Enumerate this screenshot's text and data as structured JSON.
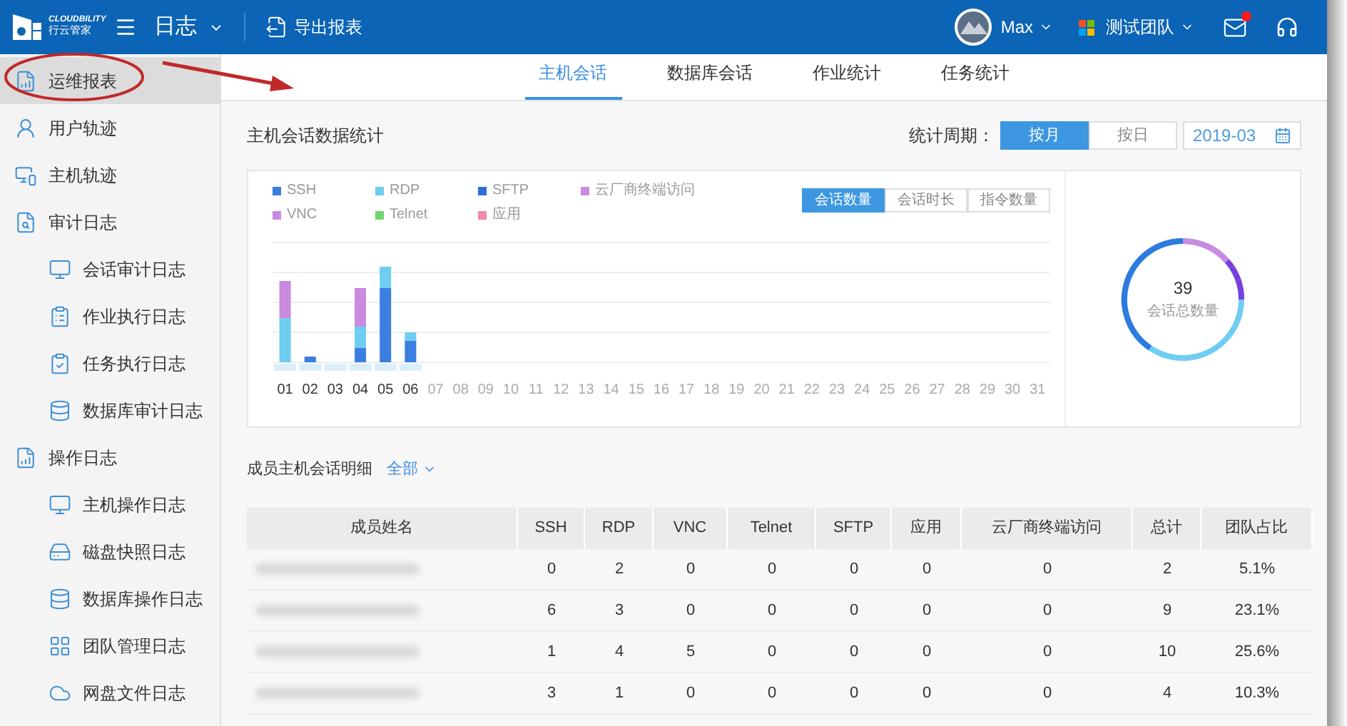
{
  "header": {
    "brand_top": "CLOUDBILITY",
    "brand_bottom": "行云管家",
    "module": "日志",
    "export": "导出报表",
    "user": "Max",
    "team": "测试团队",
    "mail_unread": true
  },
  "sidebar": {
    "items": [
      {
        "label": "运维报表",
        "kind": "report",
        "selected": true
      },
      {
        "label": "用户轨迹",
        "kind": "user",
        "selected": false
      },
      {
        "label": "主机轨迹",
        "kind": "host",
        "selected": false
      },
      {
        "label": "审计日志",
        "kind": "audit",
        "selected": false,
        "children": [
          {
            "label": "会话审计日志",
            "kind": "monitor",
            "selected": false
          },
          {
            "label": "作业执行日志",
            "kind": "clipboard",
            "selected": false
          },
          {
            "label": "任务执行日志",
            "kind": "task",
            "selected": false
          },
          {
            "label": "数据库审计日志",
            "kind": "database",
            "selected": false
          }
        ]
      },
      {
        "label": "操作日志",
        "kind": "report",
        "selected": false,
        "children": [
          {
            "label": "主机操作日志",
            "kind": "monitor",
            "selected": false
          },
          {
            "label": "磁盘快照日志",
            "kind": "disk",
            "selected": false
          },
          {
            "label": "数据库操作日志",
            "kind": "database",
            "selected": false
          },
          {
            "label": "团队管理日志",
            "kind": "grid",
            "selected": false
          },
          {
            "label": "网盘文件日志",
            "kind": "cloud",
            "selected": false
          }
        ]
      }
    ]
  },
  "tabs": [
    {
      "label": "主机会话",
      "selected": true
    },
    {
      "label": "数据库会话",
      "selected": false
    },
    {
      "label": "作业统计",
      "selected": false
    },
    {
      "label": "任务统计",
      "selected": false
    }
  ],
  "stats": {
    "title": "主机会话数据统计",
    "period_label": "统计周期：",
    "periods": [
      {
        "label": "按月",
        "selected": true
      },
      {
        "label": "按日",
        "selected": false
      }
    ],
    "date": "2019-03",
    "legend": [
      {
        "label": "SSH",
        "color": "#3a7fe0"
      },
      {
        "label": "RDP",
        "color": "#6fcdf2"
      },
      {
        "label": "SFTP",
        "color": "#2f6fdc"
      },
      {
        "label": "云厂商终端访问",
        "color": "#c98ae0"
      },
      {
        "label": "VNC",
        "color": "#c68be2"
      },
      {
        "label": "Telnet",
        "color": "#6dd66d"
      },
      {
        "label": "应用",
        "color": "#f28aa6"
      }
    ],
    "metrics": [
      {
        "label": "会话数量",
        "selected": true
      },
      {
        "label": "会话时长",
        "selected": false
      },
      {
        "label": "指令数量",
        "selected": false
      }
    ],
    "days": [
      {
        "label": "01",
        "has_data": true
      },
      {
        "label": "02",
        "has_data": true
      },
      {
        "label": "03",
        "has_data": true
      },
      {
        "label": "04",
        "has_data": true
      },
      {
        "label": "05",
        "has_data": true
      },
      {
        "label": "06",
        "has_data": true
      },
      {
        "label": "07",
        "has_data": false
      },
      {
        "label": "08",
        "has_data": false
      },
      {
        "label": "09",
        "has_data": false
      },
      {
        "label": "10",
        "has_data": false
      },
      {
        "label": "11",
        "has_data": false
      },
      {
        "label": "12",
        "has_data": false
      },
      {
        "label": "13",
        "has_data": false
      },
      {
        "label": "14",
        "has_data": false
      },
      {
        "label": "15",
        "has_data": false
      },
      {
        "label": "16",
        "has_data": false
      },
      {
        "label": "17",
        "has_data": false
      },
      {
        "label": "18",
        "has_data": false
      },
      {
        "label": "19",
        "has_data": false
      },
      {
        "label": "20",
        "has_data": false
      },
      {
        "label": "21",
        "has_data": false
      },
      {
        "label": "22",
        "has_data": false
      },
      {
        "label": "23",
        "has_data": false
      },
      {
        "label": "24",
        "has_data": false
      },
      {
        "label": "25",
        "has_data": false
      },
      {
        "label": "26",
        "has_data": false
      },
      {
        "label": "27",
        "has_data": false
      },
      {
        "label": "28",
        "has_data": false
      },
      {
        "label": "29",
        "has_data": false
      },
      {
        "label": "30",
        "has_data": false
      },
      {
        "label": "31",
        "has_data": false
      }
    ],
    "total": "39",
    "total_label": "会话总数量"
  },
  "members": {
    "title": "成员主机会话明细",
    "filter": "全部",
    "columns": [
      "成员姓名",
      "SSH",
      "RDP",
      "VNC",
      "Telnet",
      "SFTP",
      "应用",
      "云厂商终端访问",
      "总计",
      "团队占比"
    ],
    "rows": [
      {
        "values": [
          "0",
          "2",
          "0",
          "0",
          "0",
          "0",
          "0",
          "2",
          "5.1%"
        ]
      },
      {
        "values": [
          "6",
          "3",
          "0",
          "0",
          "0",
          "0",
          "0",
          "9",
          "23.1%"
        ]
      },
      {
        "values": [
          "1",
          "4",
          "5",
          "0",
          "0",
          "0",
          "0",
          "10",
          "25.6%"
        ]
      },
      {
        "values": [
          "3",
          "1",
          "0",
          "0",
          "0",
          "0",
          "0",
          "4",
          "10.3%"
        ]
      }
    ]
  }
}
